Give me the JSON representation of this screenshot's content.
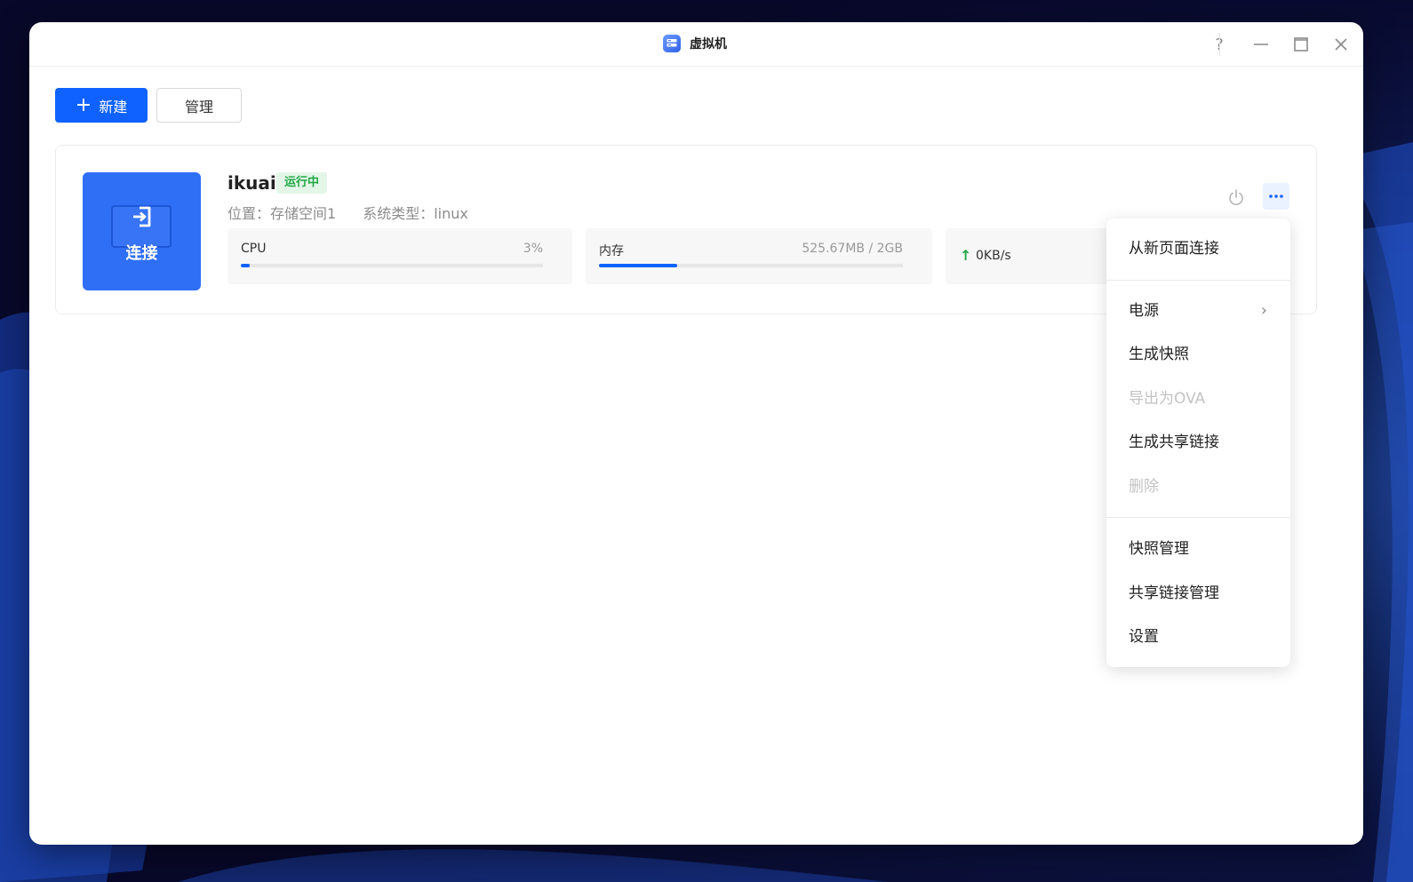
{
  "window": {
    "title": "虚拟机"
  },
  "titlebar": {
    "help_label": "?"
  },
  "toolbar": {
    "new_label": "新建",
    "manage_label": "管理"
  },
  "vm": {
    "name": "ikuai",
    "status": "运行中",
    "connect_label": "连接",
    "location": "位置：存储空间1",
    "os_type": "系统类型：linux",
    "cpu": {
      "label": "CPU",
      "value": "3%",
      "fraction": 0.03
    },
    "memory": {
      "label": "内存",
      "value": "525.67MB / 2GB",
      "fraction": 0.2567
    },
    "network": {
      "upload": "0KB/s"
    }
  },
  "menu": {
    "items": [
      {
        "label": "从新页面连接",
        "disabled": false
      },
      {
        "label": "电源",
        "disabled": false,
        "has_submenu": true
      },
      {
        "label": "生成快照",
        "disabled": false
      },
      {
        "label": "导出为OVA",
        "disabled": true
      },
      {
        "label": "生成共享链接",
        "disabled": false
      },
      {
        "label": "删除",
        "disabled": true
      },
      {
        "label": "快照管理",
        "disabled": false
      },
      {
        "label": "共享链接管理",
        "disabled": false
      },
      {
        "label": "设置",
        "disabled": false
      }
    ]
  },
  "colors": {
    "accent": "#0f62ff",
    "connect_tile": "#2f6ff6",
    "status_green": "#22a844",
    "status_bg": "#e3f6e8",
    "disabled_text": "#c3c3c3"
  }
}
